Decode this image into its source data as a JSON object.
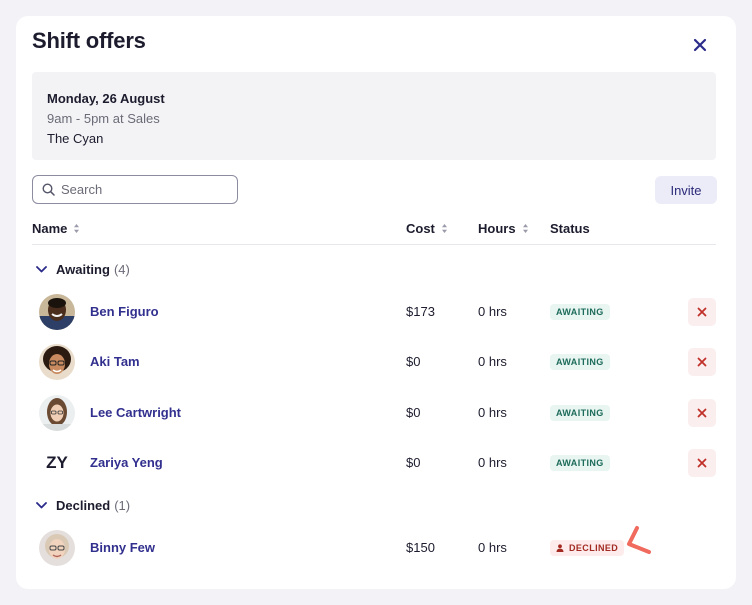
{
  "modal": {
    "title": "Shift offers",
    "close_icon": "close-icon"
  },
  "shift": {
    "date": "Monday, 26 August",
    "time": "9am - 5pm at Sales",
    "location": "The Cyan"
  },
  "search": {
    "placeholder": "Search",
    "value": "",
    "icon": "search-icon"
  },
  "invite_label": "Invite",
  "columns": {
    "name": "Name",
    "cost": "Cost",
    "hours": "Hours",
    "status": "Status"
  },
  "groups": [
    {
      "label": "Awaiting",
      "count": "(4)",
      "rows": [
        {
          "name": "Ben Figuro",
          "cost": "$173",
          "hours": "0 hrs",
          "status": "AWAITING",
          "avatar": "photo"
        },
        {
          "name": "Aki Tam",
          "cost": "$0",
          "hours": "0 hrs",
          "status": "AWAITING",
          "avatar": "photo"
        },
        {
          "name": "Lee Cartwright",
          "cost": "$0",
          "hours": "0 hrs",
          "status": "AWAITING",
          "avatar": "photo"
        },
        {
          "name": "Zariya Yeng",
          "cost": "$0",
          "hours": "0 hrs",
          "status": "AWAITING",
          "avatar": "ZY"
        }
      ]
    },
    {
      "label": "Declined",
      "count": "(1)",
      "rows": [
        {
          "name": "Binny Few",
          "cost": "$150",
          "hours": "0 hrs",
          "status": "DECLINED",
          "avatar": "photo"
        }
      ]
    }
  ],
  "colors": {
    "accent": "#32308e",
    "awaiting_bg": "#e8f5f1",
    "awaiting_text": "#1d6b5a",
    "declined_bg": "#fdeceb",
    "declined_text": "#a32a23",
    "annotation": "#f06a5e"
  }
}
